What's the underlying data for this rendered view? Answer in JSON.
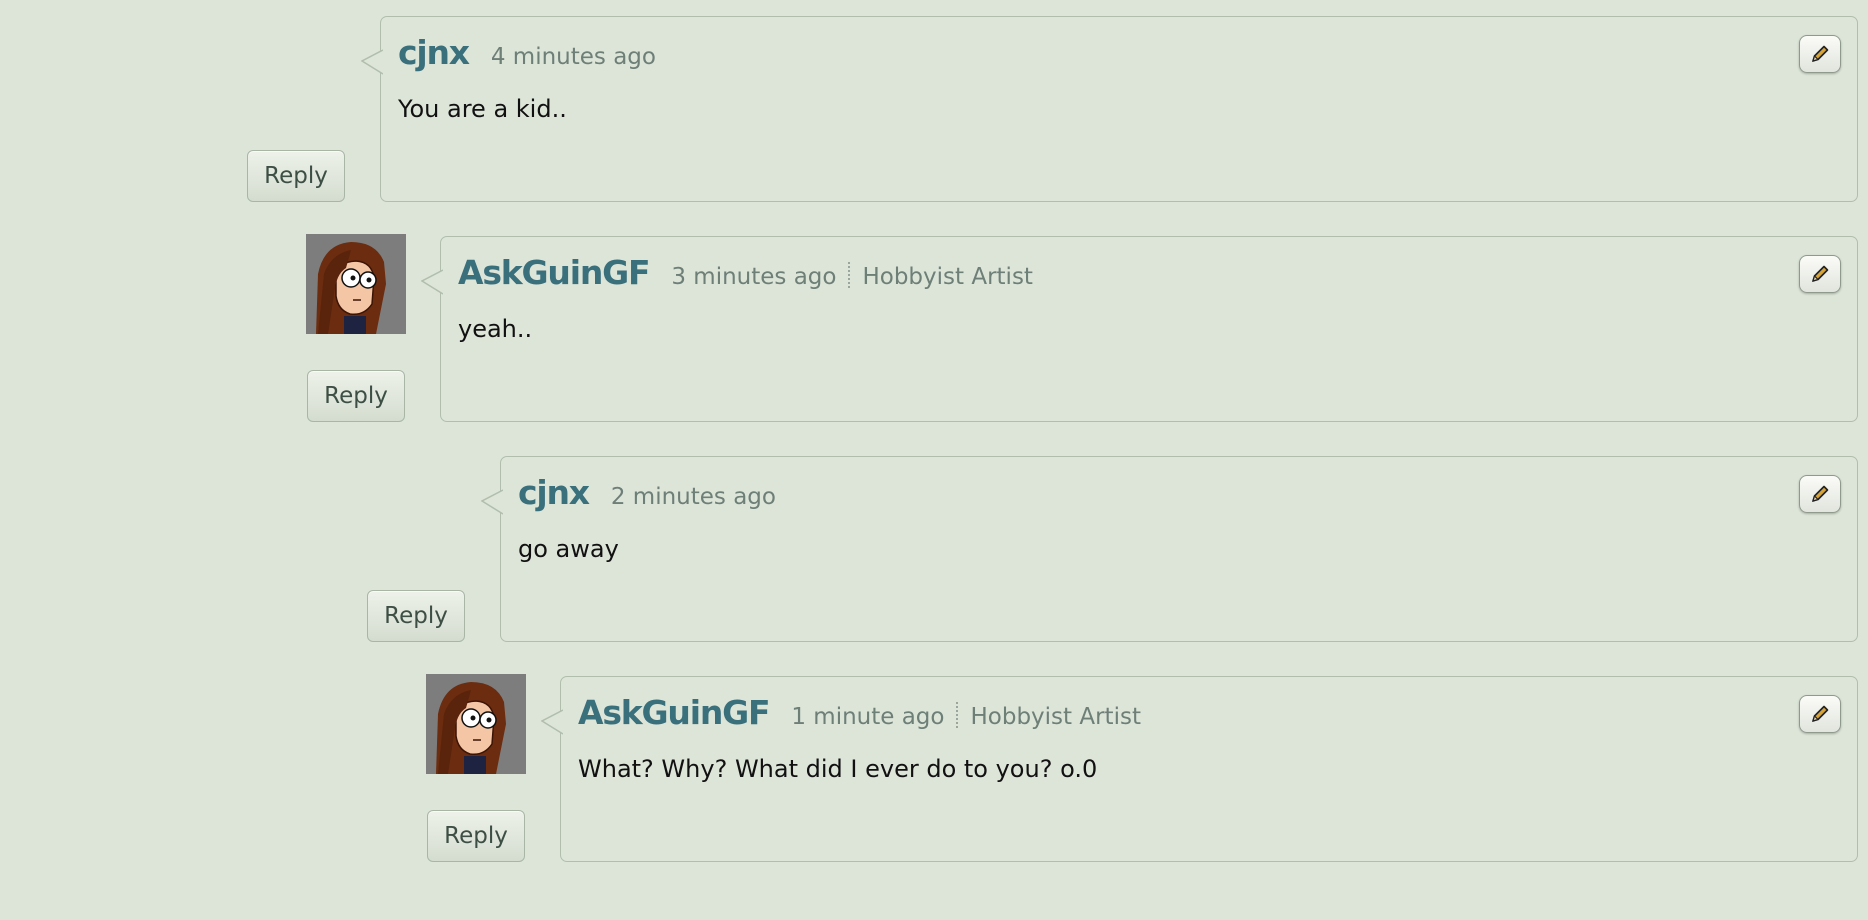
{
  "comments": [
    {
      "username": "cjnx",
      "timestamp": "4 minutes ago",
      "role": "",
      "text": "You are a kid..",
      "reply_label": "Reply",
      "has_avatar": false
    },
    {
      "username": "AskGuinGF",
      "timestamp": "3 minutes ago",
      "role": "Hobbyist Artist",
      "text": "yeah..",
      "reply_label": "Reply",
      "has_avatar": true
    },
    {
      "username": "cjnx",
      "timestamp": "2 minutes ago",
      "role": "",
      "text": "go away",
      "reply_label": "Reply",
      "has_avatar": false
    },
    {
      "username": "AskGuinGF",
      "timestamp": "1 minute ago",
      "role": "Hobbyist Artist",
      "text": "What? Why? What did I ever do to you? o.0",
      "reply_label": "Reply",
      "has_avatar": true
    }
  ],
  "icons": {
    "edit": "pencil-icon",
    "avatar": "avatar-image"
  },
  "colors": {
    "background": "#dde5d9",
    "username": "#3a6f7c",
    "meta": "#6e7f78",
    "border": "#b1bead"
  }
}
